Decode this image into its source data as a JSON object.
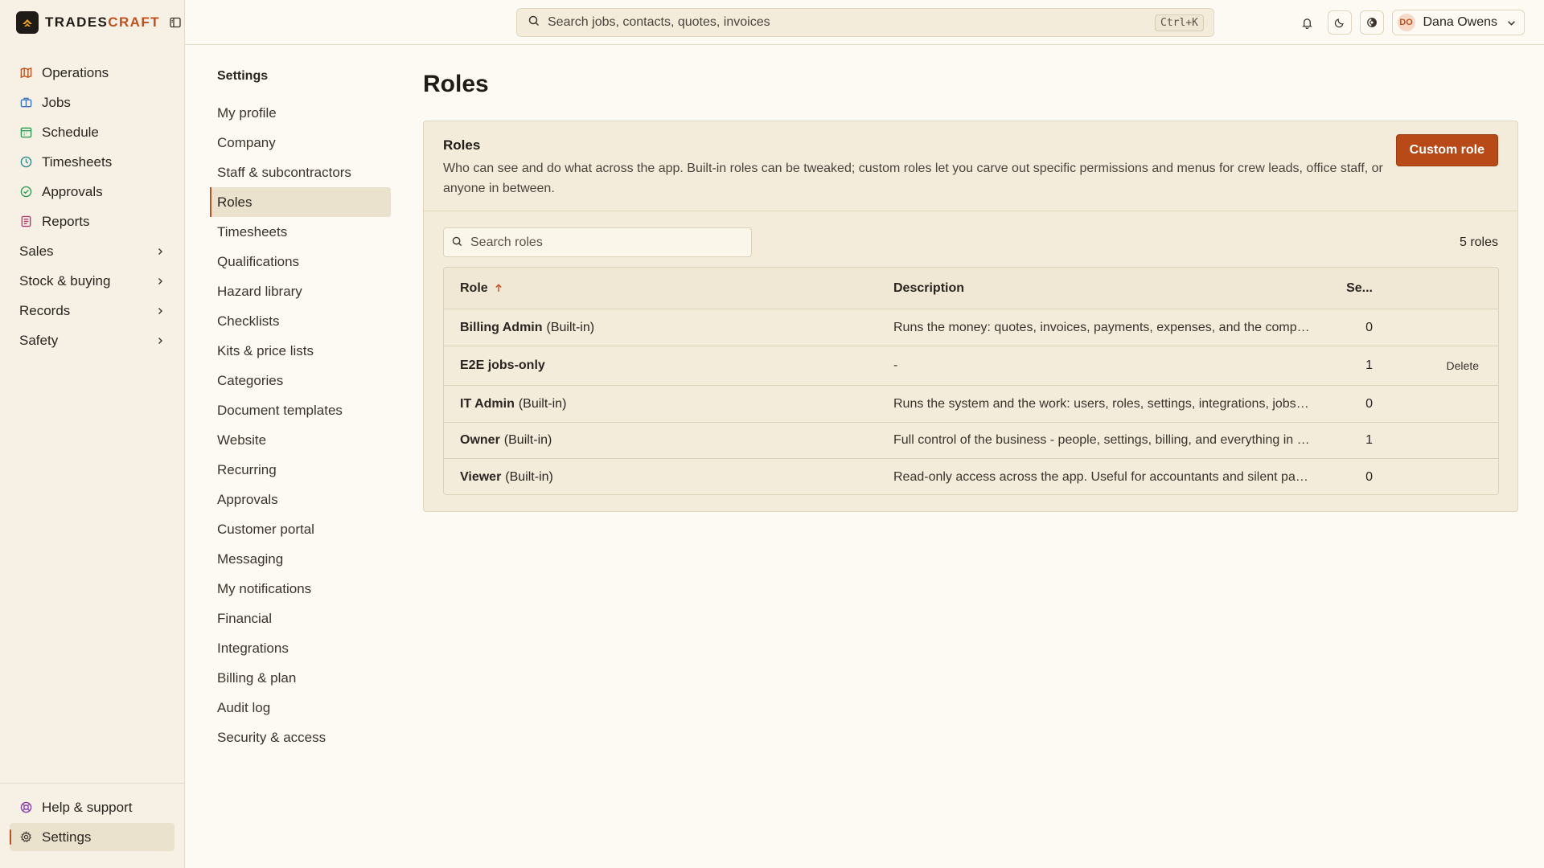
{
  "brand": {
    "name_part1": "TRADES",
    "name_part2": "CRAFT"
  },
  "search": {
    "placeholder": "Search jobs, contacts, quotes, invoices",
    "shortcut": "Ctrl+K"
  },
  "user": {
    "initials": "DO",
    "name": "Dana Owens"
  },
  "sidebar": {
    "items": [
      {
        "label": "Operations",
        "icon": "map-icon",
        "color": "#c0501e"
      },
      {
        "label": "Jobs",
        "icon": "briefcase-icon",
        "color": "#3b74c4"
      },
      {
        "label": "Schedule",
        "icon": "calendar-icon",
        "color": "#2f9a55"
      },
      {
        "label": "Timesheets",
        "icon": "clock-icon",
        "color": "#2b8a8a"
      },
      {
        "label": "Approvals",
        "icon": "check-circle-icon",
        "color": "#2f9a55"
      },
      {
        "label": "Reports",
        "icon": "report-icon",
        "color": "#b8386e"
      }
    ],
    "groups": [
      {
        "label": "Sales"
      },
      {
        "label": "Stock & buying"
      },
      {
        "label": "Records"
      },
      {
        "label": "Safety"
      }
    ],
    "footer": [
      {
        "label": "Help & support",
        "icon": "lifebuoy-icon",
        "color": "#8a3fb0"
      },
      {
        "label": "Settings",
        "icon": "gear-icon",
        "color": "#4a443c"
      }
    ]
  },
  "settings_nav": {
    "title": "Settings",
    "items": [
      "My profile",
      "Company",
      "Staff & subcontractors",
      "Roles",
      "Timesheets",
      "Qualifications",
      "Hazard library",
      "Checklists",
      "Kits & price lists",
      "Categories",
      "Document templates",
      "Website",
      "Recurring",
      "Approvals",
      "Customer portal",
      "Messaging",
      "My notifications",
      "Financial",
      "Integrations",
      "Billing & plan",
      "Audit log",
      "Security & access"
    ],
    "active": "Roles"
  },
  "page": {
    "title": "Roles",
    "card_title": "Roles",
    "card_description": "Who can see and do what across the app. Built-in roles can be tweaked; custom roles let you carve out specific permissions and menus for crew leads, office staff, or anyone in between.",
    "primary_button": "Custom role",
    "roles_search_placeholder": "Search roles",
    "count_label": "5 roles"
  },
  "table": {
    "columns": {
      "role": "Role",
      "description": "Description",
      "seats": "Se..."
    },
    "rows": [
      {
        "name": "Billing Admin",
        "suffix": "(Built-in)",
        "description": "Runs the money: quotes, invoices, payments, expenses, and the company...",
        "seats": "0",
        "action": ""
      },
      {
        "name": "E2E jobs-only",
        "suffix": "",
        "description": "-",
        "seats": "1",
        "action": "Delete"
      },
      {
        "name": "IT Admin",
        "suffix": "(Built-in)",
        "description": "Runs the system and the work: users, roles, settings, integrations, jobs, q...",
        "seats": "0",
        "action": ""
      },
      {
        "name": "Owner",
        "suffix": "(Built-in)",
        "description": "Full control of the business - people, settings, billing, and everything in th...",
        "seats": "1",
        "action": ""
      },
      {
        "name": "Viewer",
        "suffix": "(Built-in)",
        "description": "Read-only access across the app. Useful for accountants and silent partne...",
        "seats": "0",
        "action": ""
      }
    ]
  }
}
